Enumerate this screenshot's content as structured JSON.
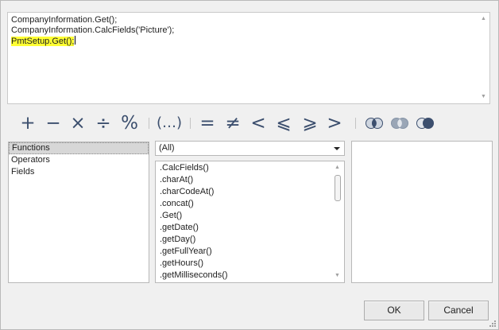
{
  "editor": {
    "lines": [
      "CompanyInformation.Get();",
      "CompanyInformation.CalcFields('Picture');",
      "PmtSetup.Get();"
    ]
  },
  "operators": [
    "+",
    "−",
    "×",
    "÷",
    "%",
    "(…)",
    "=",
    "≠",
    "<",
    "⩽",
    "⩾",
    ">"
  ],
  "categories": {
    "items": [
      "Functions",
      "Operators",
      "Fields"
    ],
    "selected": "Functions"
  },
  "filter": {
    "value": "(All)"
  },
  "functions": [
    ".CalcFields()",
    ".charAt()",
    ".charCodeAt()",
    ".concat()",
    ".Get()",
    ".getDate()",
    ".getDay()",
    ".getFullYear()",
    ".getHours()",
    ".getMilliseconds()"
  ],
  "buttons": {
    "ok": "OK",
    "cancel": "Cancel"
  },
  "colors": {
    "highlight": "#ffff33",
    "operator": "#3c4f6e"
  }
}
